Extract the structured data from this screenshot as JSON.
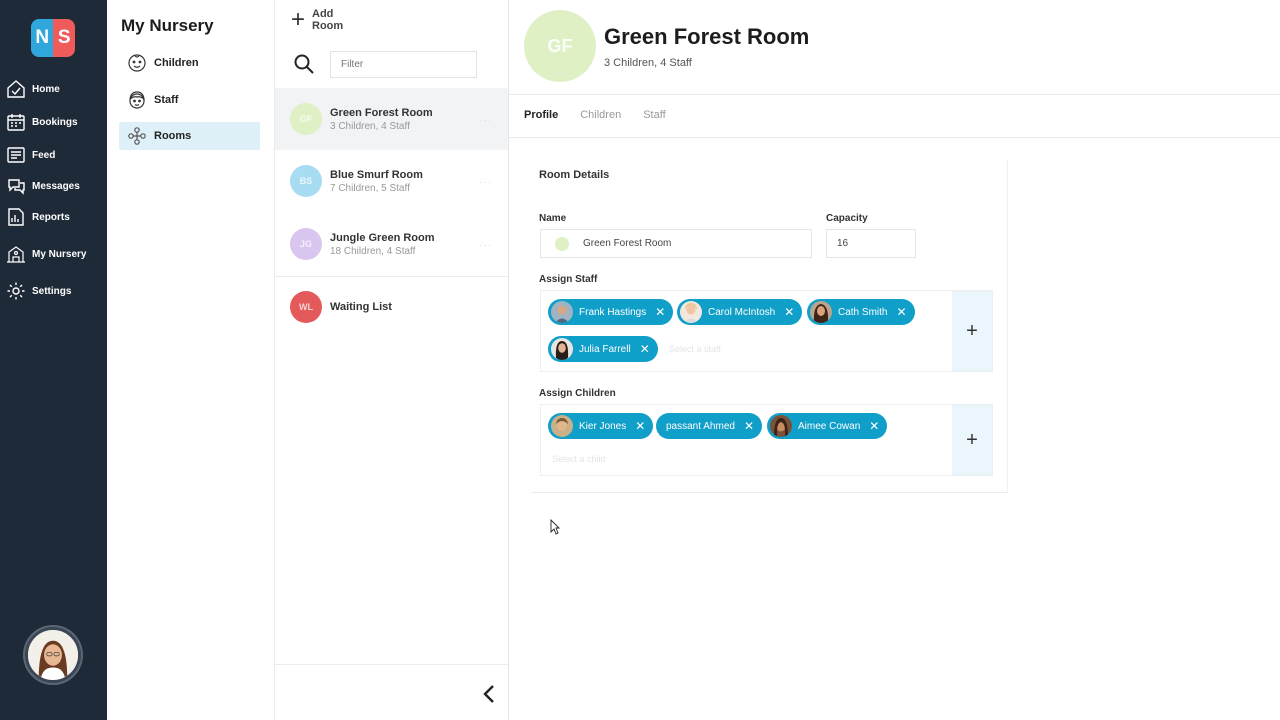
{
  "app": {
    "logo_left": "N",
    "logo_right": "S"
  },
  "nav": {
    "items": [
      {
        "label": "Home",
        "icon": "home-icon"
      },
      {
        "label": "Bookings",
        "icon": "calendar-icon"
      },
      {
        "label": "Feed",
        "icon": "feed-icon"
      },
      {
        "label": "Messages",
        "icon": "messages-icon"
      },
      {
        "label": "Reports",
        "icon": "reports-icon"
      },
      {
        "label": "My Nursery",
        "icon": "nursery-icon"
      },
      {
        "label": "Settings",
        "icon": "gear-icon"
      }
    ],
    "active": "My Nursery"
  },
  "section": {
    "title": "My Nursery",
    "items": [
      {
        "label": "Children",
        "icon": "child-face-icon"
      },
      {
        "label": "Staff",
        "icon": "staff-face-icon"
      },
      {
        "label": "Rooms",
        "icon": "rooms-icon"
      }
    ],
    "active": "Rooms"
  },
  "rooms_list": {
    "add_label": "Add Room",
    "search_placeholder": "Filter",
    "rooms": [
      {
        "initials": "GF",
        "name": "Green Forest Room",
        "counts": "3 Children, 4 Staff",
        "color": "#dff0c4"
      },
      {
        "initials": "BS",
        "name": "Blue Smurf Room",
        "counts": "7 Children, 5 Staff",
        "color": "#a8dcf2"
      },
      {
        "initials": "JG",
        "name": "Jungle Green Room",
        "counts": "18 Children, 4 Staff",
        "color": "#d9c6ef"
      },
      {
        "initials": "WL",
        "name": "Waiting List",
        "counts": "",
        "color": "#e45a5a"
      }
    ]
  },
  "room": {
    "initials": "GF",
    "title": "Green Forest Room",
    "summary": "3 Children, 4 Staff",
    "tabs": [
      "Profile",
      "Children",
      "Staff"
    ],
    "active_tab": "Profile"
  },
  "details": {
    "title": "Room Details",
    "name_label": "Name",
    "name_value": "Green Forest Room",
    "capacity_label": "Capacity",
    "capacity_value": "16",
    "assign_staff_label": "Assign Staff",
    "staff": [
      "Frank Hastings",
      "Carol McIntosh",
      "Cath Smith",
      "Julia Farrell"
    ],
    "staff_placeholder": "Select a staff",
    "assign_children_label": "Assign Children",
    "children": [
      "Kier Jones",
      "passant Ahmed",
      "Aimee Cowan"
    ],
    "children_placeholder": "Select a child"
  },
  "colors": {
    "nav_bg": "#1f2a38",
    "chip": "#0f9fc9",
    "active_sub": "#dff1f8"
  }
}
